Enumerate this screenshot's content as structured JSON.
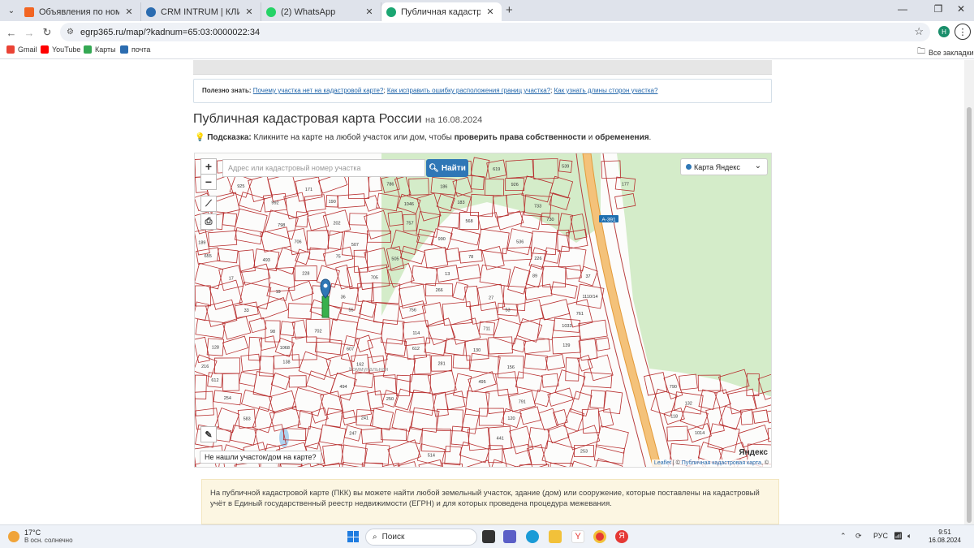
{
  "browser": {
    "tabs": [
      {
        "title": "Объявления по номеру телеф",
        "favicon_color": "#f26522"
      },
      {
        "title": "CRM INTRUM | КЛИЕНТ ПЛЮС",
        "favicon_color": "#2b6cb0"
      },
      {
        "title": "(2) WhatsApp",
        "favicon_color": "#25d366"
      },
      {
        "title": "Публичная кадастровая карта",
        "favicon_color": "#1ba672"
      }
    ],
    "url": "egrp365.ru/map/?kadnum=65:03:0000022:34",
    "profile_initial": "Н",
    "bookmarks": [
      "Gmail",
      "YouTube",
      "Карты",
      "почта"
    ],
    "all_bookmarks": "Все закладки"
  },
  "page": {
    "tips_label": "Полезно знать:",
    "tips_links": [
      "Почему участка нет на кадастровой карте?",
      "Как исправить ошибку расположения границ участка?",
      "Как узнать длины сторон участка?"
    ],
    "title": "Публичная кадастровая карта России",
    "title_date": "на 16.08.2024",
    "hint_label": "Подсказка:",
    "hint_pre": "Кликните на карте на любой участок или дом, чтобы",
    "hint_bold": "проверить права собственности",
    "hint_and": "и",
    "hint_bold2": "обременения",
    "hint_end": ".",
    "map": {
      "search_placeholder": "Адрес или кадастровый номер участка",
      "search_button": "Найти",
      "layer_select": "Карта Яндекс",
      "not_found": "Не нашли участок/дом на карте?",
      "attribution_leaflet": "Leaflet",
      "attribution_sep": " | © ",
      "attribution_pkk": "Публичная кадастровая карта",
      "attribution_end": ", ©",
      "yandex": "Яндекс",
      "road_label": "А-391",
      "parcel_labels": [
        "529",
        "539",
        "171",
        "186",
        "177",
        "190",
        "183",
        "225",
        "202",
        "568",
        "189",
        "507",
        "536",
        "493",
        "505",
        "226",
        "228",
        "13",
        "37",
        "36",
        "27",
        "33",
        "756",
        "761",
        "702",
        "711",
        "128",
        "607",
        "130",
        "216",
        "162",
        "156",
        "612",
        "494",
        "495",
        "790",
        "254",
        "250",
        "791",
        "132",
        "583",
        "241",
        "120",
        "118",
        "490",
        "247",
        "441",
        "1014",
        "1015",
        "514",
        "253",
        "222",
        "1052",
        "986",
        "623",
        "619",
        "925",
        "786",
        "926",
        "992",
        "1046",
        "733",
        "798",
        "757",
        "730",
        "706",
        "990",
        "655",
        "75",
        "78",
        "17",
        "705",
        "89",
        "19",
        "266",
        "1110/14",
        "55",
        "53",
        "98",
        "114",
        "1033",
        "1068",
        "612",
        "139",
        "138",
        "281"
      ],
      "street_label": "Коммунальная"
    },
    "info": "На публичной кадастровой карте (ПКК) вы можете найти любой земельный участок, здание (дом) или сооружение, которые поставлены на кадастровый учёт в Единый государственный реестр недвижимости (ЕГРН) и для которых проведена процедура межевания."
  },
  "taskbar": {
    "temp": "17°C",
    "weather": "В осн. солнечно",
    "search": "Поиск",
    "lang": "РУС",
    "time": "9:51",
    "date": "16.08.2024"
  }
}
